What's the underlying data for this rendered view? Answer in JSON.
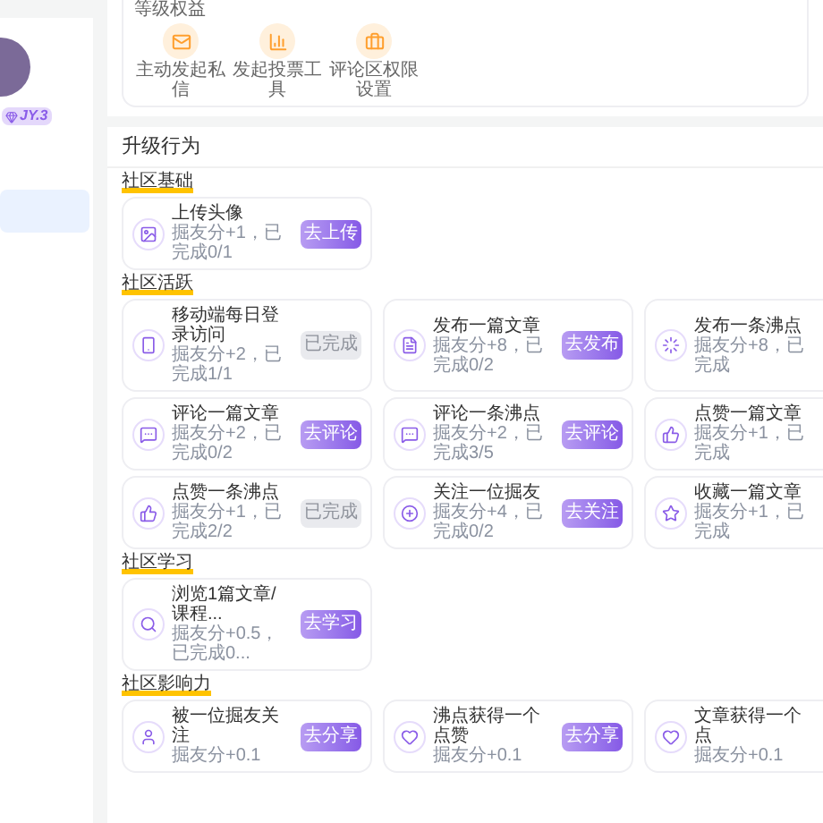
{
  "sidebar": {
    "badge": "JY.3",
    "nav_items": [
      {
        "selected": true
      }
    ]
  },
  "benefits": {
    "title": "等级权益",
    "items": [
      {
        "label": "主动发起私信"
      },
      {
        "label": "发起投票工具"
      },
      {
        "label": "评论区权限设置"
      }
    ]
  },
  "upgrade": {
    "title": "升级行为",
    "sections": [
      {
        "title": "社区基础",
        "tasks": [
          {
            "title": "上传头像",
            "reward": "掘友分+1，已完成0/1",
            "button": "去上传",
            "completed": false
          }
        ]
      },
      {
        "title": "社区活跃",
        "tasks": [
          {
            "title": "移动端每日登录访问",
            "reward": "掘友分+2，已完成1/1",
            "button": "已完成",
            "completed": true
          },
          {
            "title": "发布一篇文章",
            "reward": "掘友分+8，已完成0/2",
            "button": "去发布",
            "completed": false
          },
          {
            "title": "发布一条沸点",
            "reward": "掘友分+8，已完成"
          },
          {
            "title": "评论一篇文章",
            "reward": "掘友分+2，已完成0/2",
            "button": "去评论",
            "completed": false
          },
          {
            "title": "评论一条沸点",
            "reward": "掘友分+2，已完成3/5",
            "button": "去评论",
            "completed": false
          },
          {
            "title": "点赞一篇文章",
            "reward": "掘友分+1，已完成"
          },
          {
            "title": "点赞一条沸点",
            "reward": "掘友分+1，已完成2/2",
            "button": "已完成",
            "completed": true
          },
          {
            "title": "关注一位掘友",
            "reward": "掘友分+4，已完成0/2",
            "button": "去关注",
            "completed": false
          },
          {
            "title": "收藏一篇文章",
            "reward": "掘友分+1，已完成"
          }
        ]
      },
      {
        "title": "社区学习",
        "tasks": [
          {
            "title": "浏览1篇文章/课程...",
            "reward": "掘友分+0.5，已完成0...",
            "button": "去学习",
            "completed": false
          }
        ]
      },
      {
        "title": "社区影响力",
        "tasks": [
          {
            "title": "被一位掘友关注",
            "reward": "掘友分+0.1",
            "button": "去分享",
            "completed": false
          },
          {
            "title": "沸点获得一个点赞",
            "reward": "掘友分+0.1",
            "button": "去分享",
            "completed": false
          },
          {
            "title": "文章获得一个点",
            "reward": "掘友分+0.1"
          }
        ]
      }
    ]
  }
}
